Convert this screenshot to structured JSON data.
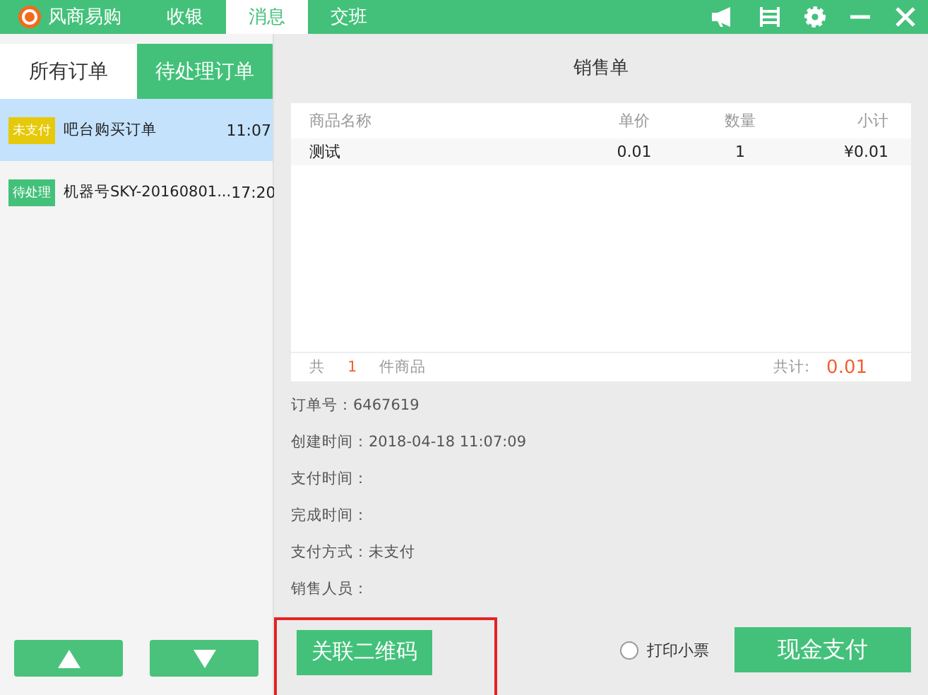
{
  "topbar": {
    "logo": "风商易购",
    "tabs": [
      {
        "label": "收银",
        "selected": false
      },
      {
        "label": "消息",
        "selected": true
      },
      {
        "label": "交班",
        "selected": false
      }
    ]
  },
  "order_tabs": [
    {
      "label": "所有订单",
      "selected": false
    },
    {
      "label": "待处理订单",
      "selected": true
    }
  ],
  "orders": [
    {
      "status": "未支付",
      "kind": "unpaid",
      "title": "吧台购买订单",
      "time": "11:07",
      "selected": true
    },
    {
      "status": "待处理",
      "kind": "pending",
      "title": "机器号SKY-20160801...",
      "time": "17:20",
      "selected": false
    }
  ],
  "detail": {
    "title": "销售单",
    "table": {
      "columns": [
        "商品名称",
        "单价",
        "数量",
        "小计"
      ],
      "rows": [
        [
          "测试",
          "0.01",
          "1",
          "¥0.01"
        ]
      ],
      "footer": {
        "prefix": "共",
        "count": "1",
        "suffix": "件商品",
        "total_label": "共计:",
        "total": "0.01"
      }
    },
    "fields": [
      "订单号：6467619",
      "创建时间：2018-04-18 11:07:09",
      "支付时间：",
      "完成时间：",
      "支付方式：未支付",
      "销售人员："
    ],
    "link_button": "关联二维码",
    "print_option": {
      "label": "打印小票",
      "checked": false
    },
    "pay_button": "现金支付"
  }
}
